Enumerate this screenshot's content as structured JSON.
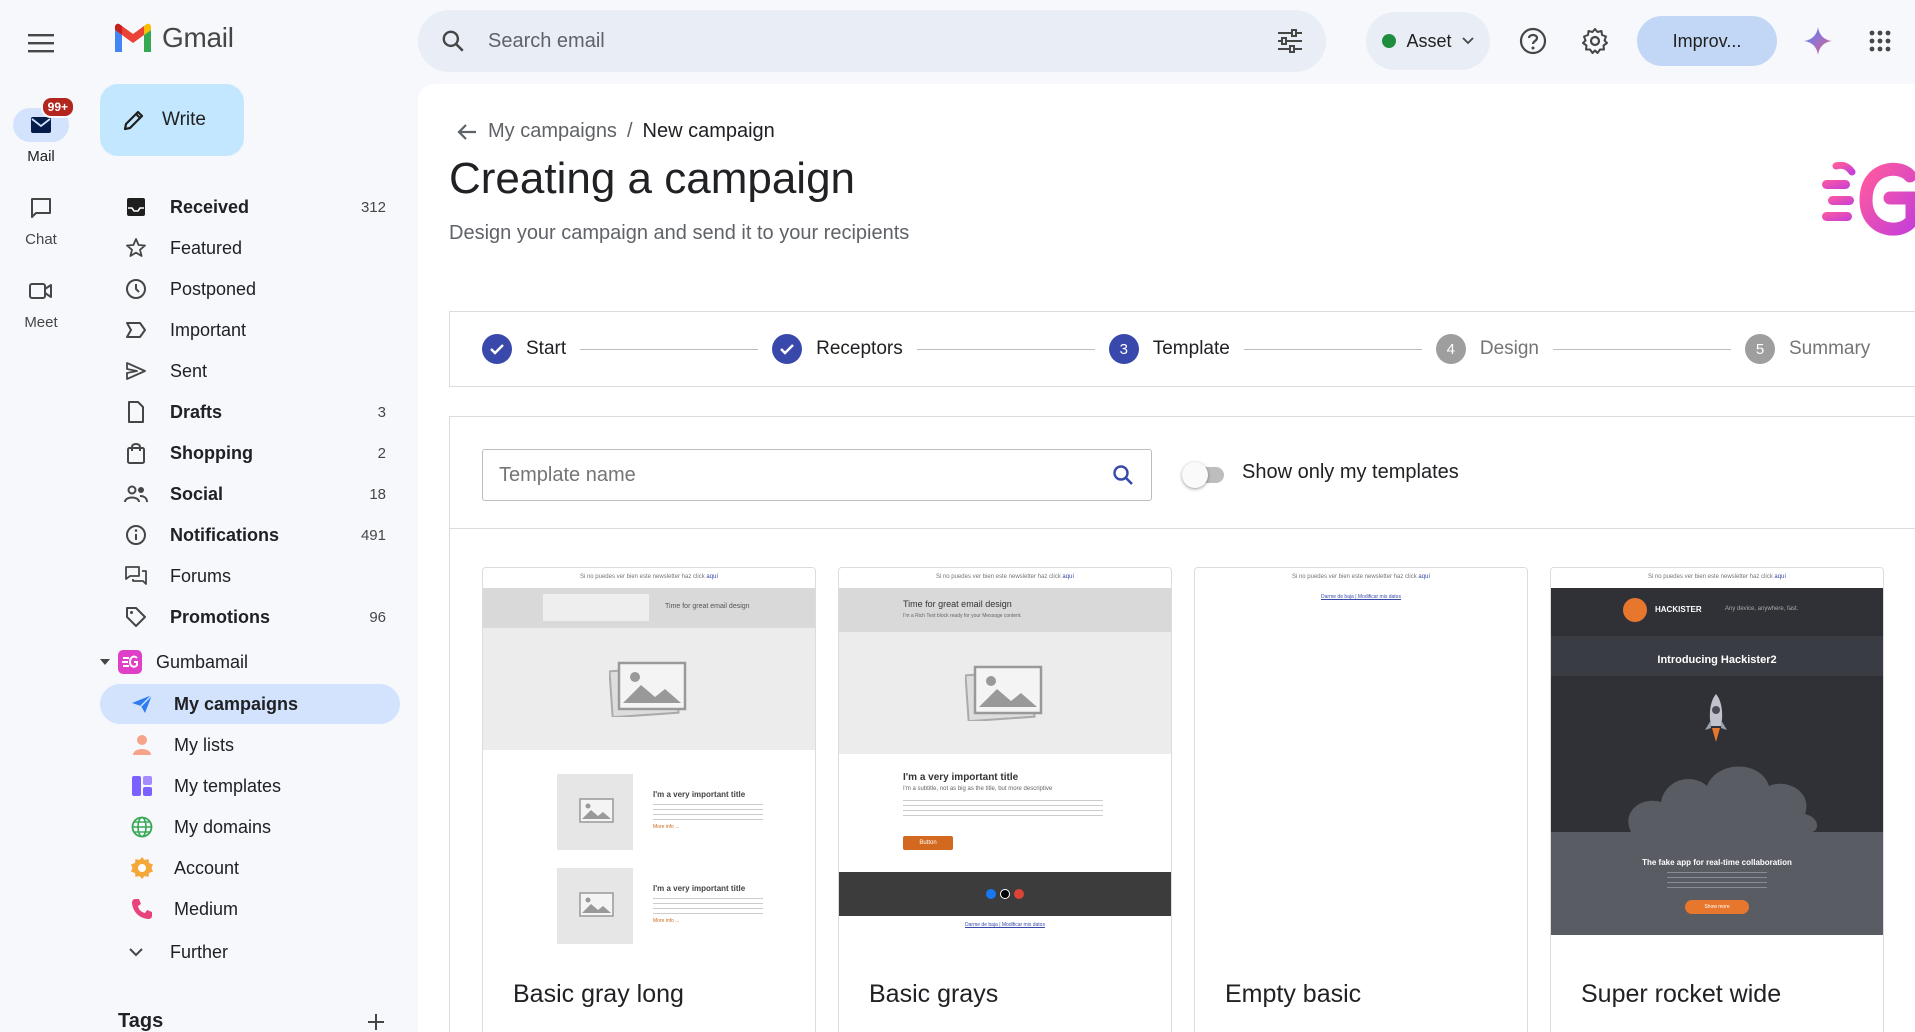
{
  "app": {
    "logo_text": "Gmail"
  },
  "search": {
    "placeholder": "Search email"
  },
  "header": {
    "account_label": "Asset",
    "improve_label": "Improv..."
  },
  "rail": {
    "mail_label": "Mail",
    "mail_badge": "99+",
    "chat_label": "Chat",
    "meet_label": "Meet"
  },
  "sidebar": {
    "write_label": "Write",
    "items": [
      {
        "label": "Received",
        "count": "312",
        "bold": true
      },
      {
        "label": "Featured",
        "count": ""
      },
      {
        "label": "Postponed",
        "count": ""
      },
      {
        "label": "Important",
        "count": ""
      },
      {
        "label": "Sent",
        "count": ""
      },
      {
        "label": "Drafts",
        "count": "3",
        "bold": true
      },
      {
        "label": "Shopping",
        "count": "2",
        "bold": true
      },
      {
        "label": "Social",
        "count": "18",
        "bold": true
      },
      {
        "label": "Notifications",
        "count": "491",
        "bold": true
      },
      {
        "label": "Forums",
        "count": ""
      },
      {
        "label": "Promotions",
        "count": "96",
        "bold": true
      }
    ],
    "addon_label": "Gumbamail",
    "addon_items": [
      {
        "label": "My campaigns"
      },
      {
        "label": "My lists"
      },
      {
        "label": "My templates"
      },
      {
        "label": "My domains"
      },
      {
        "label": "Account"
      },
      {
        "label": "Medium"
      }
    ],
    "further_label": "Further",
    "tags_label": "Tags"
  },
  "main": {
    "breadcrumb_parent": "My campaigns",
    "breadcrumb_sep": "/",
    "breadcrumb_current": "New campaign",
    "title": "Creating a campaign",
    "subtitle": "Design your campaign and send it to your recipients",
    "steps": [
      {
        "num": "1",
        "label": "Start",
        "state": "done"
      },
      {
        "num": "2",
        "label": "Receptors",
        "state": "done"
      },
      {
        "num": "3",
        "label": "Template",
        "state": "current"
      },
      {
        "num": "4",
        "label": "Design",
        "state": "todo"
      },
      {
        "num": "5",
        "label": "Summary",
        "state": "todo"
      }
    ],
    "template_search_placeholder": "Template name",
    "toggle_label": "Show only my templates",
    "templates": [
      {
        "name": "Basic gray long"
      },
      {
        "name": "Basic grays"
      },
      {
        "name": "Empty basic"
      },
      {
        "name": "Super rocket wide"
      }
    ],
    "thumb_text": {
      "top_note": "Si no puedes ver bien este newsletter haz click",
      "top_link": "aquí",
      "header_title": "Time for great email design",
      "header_sub": "I'm a Rich Text block ready for your Message content.",
      "block_title": "I'm a very important title",
      "block_sub": "I'm a subtitle, not as big as the title, but more descriptive",
      "more_link": "More info ...",
      "button": "Button",
      "footer_links": "Darme de baja | Modificar mis datos",
      "hackister_brand": "HACKISTER",
      "hackister_tag": "Any device, anywhere, fast.",
      "hackister_title": "Introducing Hackister2",
      "hackister_sub": "The fake app for real-time collaboration",
      "hackister_btn": "Show more"
    }
  },
  "colors": {
    "accent": "#3949ab",
    "active_nav": "#d3e3fd",
    "write": "#c2e7ff",
    "brand_pink": "#e040c8"
  }
}
